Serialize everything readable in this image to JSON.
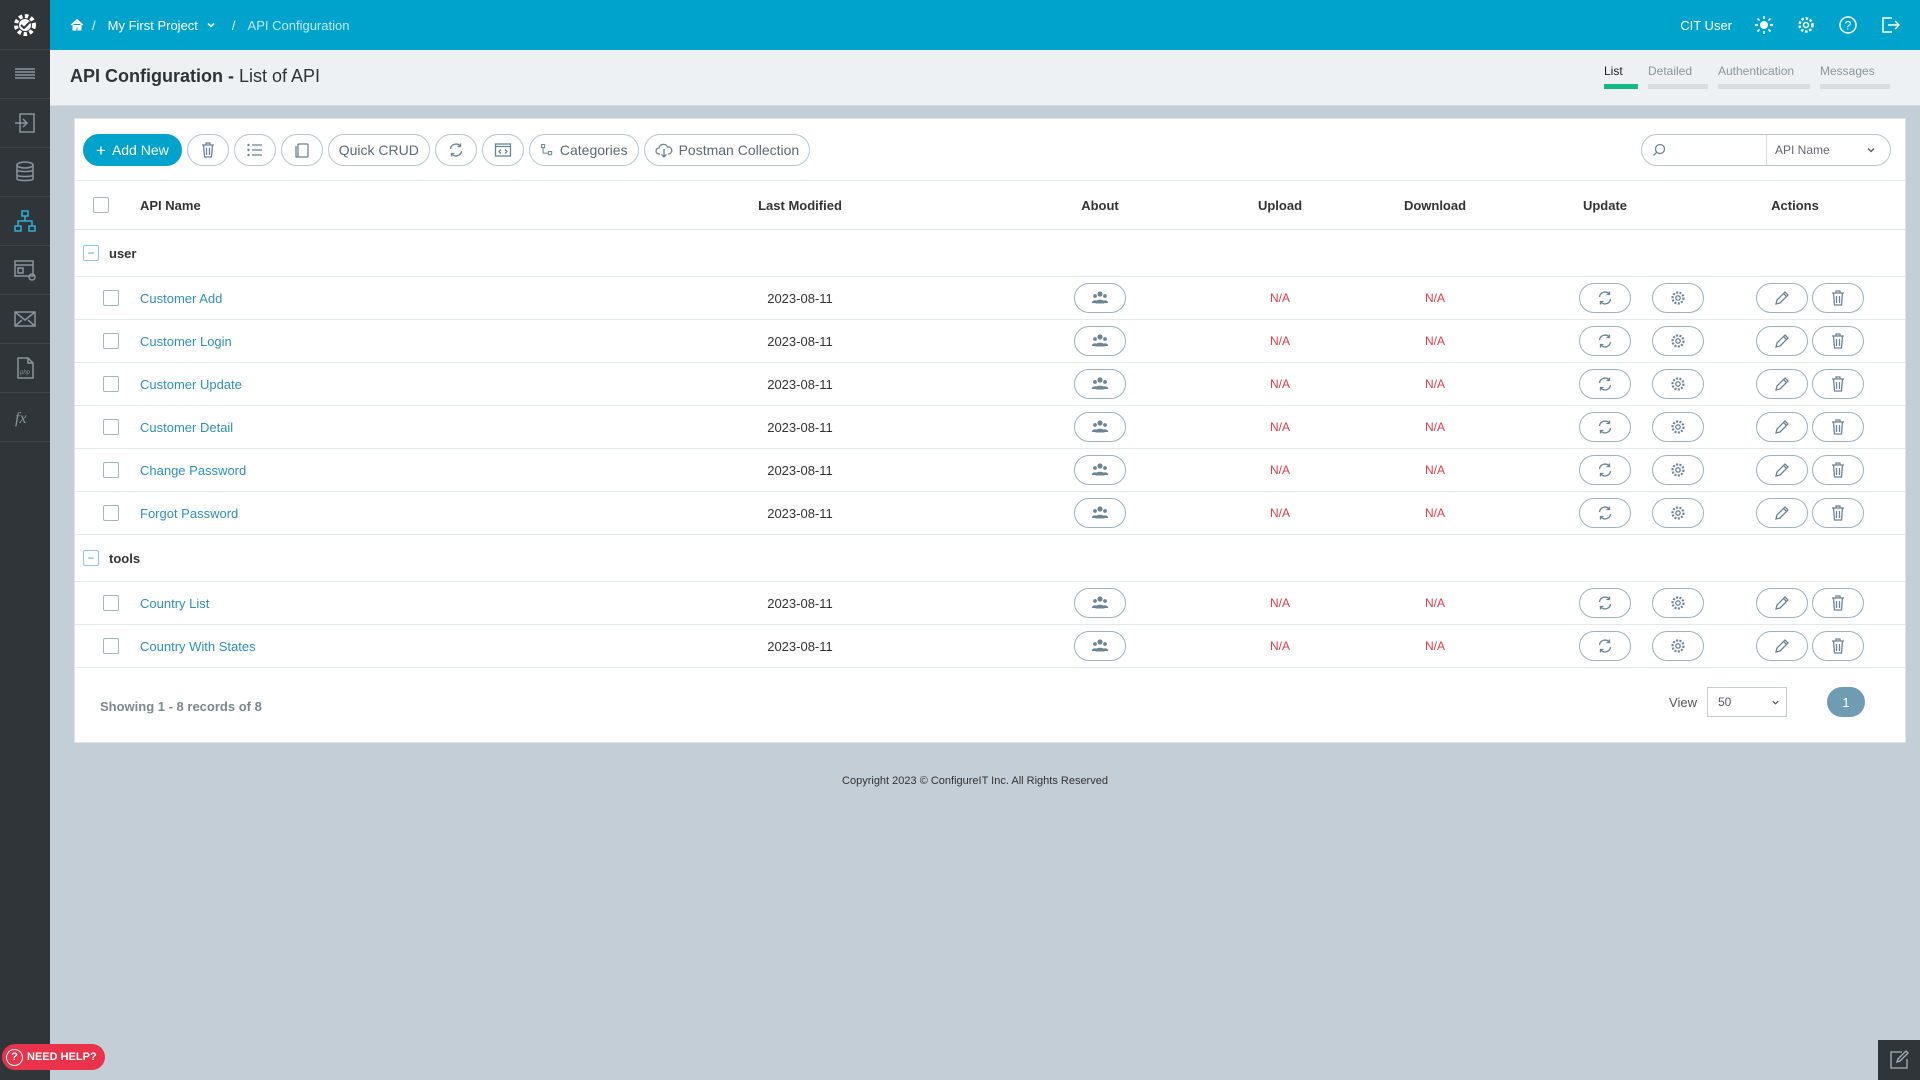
{
  "breadcrumb": {
    "sep": "/",
    "project": "My First Project",
    "current": "API Configuration"
  },
  "topbar": {
    "user": "CIT User"
  },
  "page": {
    "title_bold": "API Configuration -",
    "title_rest": " List of API",
    "tabs": [
      "List",
      "Detailed",
      "Authentication",
      "Messages"
    ],
    "active_tab": "List"
  },
  "toolbar": {
    "add_new": "Add New",
    "quick_crud": "Quick CRUD",
    "categories": "Categories",
    "postman": "Postman Collection",
    "search_placeholder": "",
    "search_field": "API Name"
  },
  "table": {
    "headers": {
      "name": "API Name",
      "modified": "Last Modified",
      "about": "About",
      "upload": "Upload",
      "download": "Download",
      "update": "Update",
      "actions": "Actions"
    },
    "groups": [
      {
        "name": "user",
        "rows": [
          {
            "name": "Customer Add",
            "modified": "2023-08-11",
            "upload": "N/A",
            "download": "N/A"
          },
          {
            "name": "Customer Login",
            "modified": "2023-08-11",
            "upload": "N/A",
            "download": "N/A"
          },
          {
            "name": "Customer Update",
            "modified": "2023-08-11",
            "upload": "N/A",
            "download": "N/A"
          },
          {
            "name": "Customer Detail",
            "modified": "2023-08-11",
            "upload": "N/A",
            "download": "N/A"
          },
          {
            "name": "Change Password",
            "modified": "2023-08-11",
            "upload": "N/A",
            "download": "N/A"
          },
          {
            "name": "Forgot Password",
            "modified": "2023-08-11",
            "upload": "N/A",
            "download": "N/A"
          }
        ]
      },
      {
        "name": "tools",
        "rows": [
          {
            "name": "Country List",
            "modified": "2023-08-11",
            "upload": "N/A",
            "download": "N/A"
          },
          {
            "name": "Country With States",
            "modified": "2023-08-11",
            "upload": "N/A",
            "download": "N/A"
          }
        ]
      }
    ]
  },
  "footer": {
    "showing": "Showing 1 - 8 records of 8",
    "view_label": "View",
    "view_value": "50",
    "page": "1"
  },
  "copyright": "Copyright 2023 © ConfigureIT Inc. All Rights Reserved",
  "need_help": "NEED HELP?",
  "colors": {
    "brand": "#00a3cc",
    "sidebar": "#2f3539",
    "na": "#e83a4b",
    "link": "#2f8fbd",
    "active_tab": "#12b886"
  }
}
